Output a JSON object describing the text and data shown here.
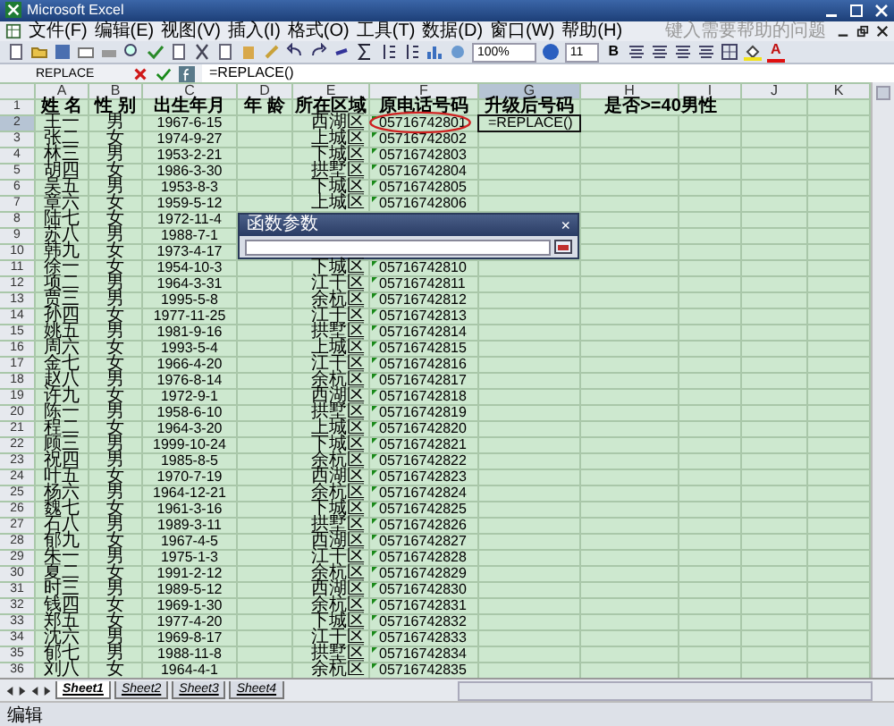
{
  "window": {
    "title": "Microsoft Excel"
  },
  "menu": [
    "文件(F)",
    "编辑(E)",
    "视图(V)",
    "插入(I)",
    "格式(O)",
    "工具(T)",
    "数据(D)",
    "窗口(W)",
    "帮助(H)"
  ],
  "help_box": {
    "placeholder": "键入需要帮助的问题"
  },
  "toolbar": {
    "zoom": "100%",
    "font_size": "11",
    "bold": "B",
    "font_color": "A"
  },
  "formula_bar": {
    "name_box": "REPLACE",
    "formula": "=REPLACE()"
  },
  "columns": [
    {
      "letter": "A",
      "selected": false
    },
    {
      "letter": "B",
      "selected": false
    },
    {
      "letter": "C",
      "selected": false
    },
    {
      "letter": "D",
      "selected": false
    },
    {
      "letter": "E",
      "selected": false
    },
    {
      "letter": "F",
      "selected": false
    },
    {
      "letter": "G",
      "selected": true
    },
    {
      "letter": "H",
      "selected": false
    },
    {
      "letter": "I",
      "selected": false
    },
    {
      "letter": "J",
      "selected": false
    },
    {
      "letter": "K",
      "selected": false
    }
  ],
  "rows": [
    {
      "number": "1",
      "selected": false,
      "header": true,
      "flagged": false,
      "cells": {
        "A": "姓 名",
        "B": "性 别",
        "C": "出生年月",
        "D": "年 龄",
        "E": "所在区域",
        "F": "原电话号码",
        "G": "升级后号码",
        "H": "是否>=40男性"
      }
    },
    {
      "number": "2",
      "selected": true,
      "header": false,
      "flagged": true,
      "cells": {
        "A": "王一",
        "B": "男",
        "C": "1967-6-15",
        "E": "西湖区",
        "F": "05716742801",
        "G": "=REPLACE()"
      }
    },
    {
      "number": "3",
      "selected": false,
      "header": false,
      "flagged": true,
      "cells": {
        "A": "张二",
        "B": "女",
        "C": "1974-9-27",
        "E": "上城区",
        "F": "05716742802"
      }
    },
    {
      "number": "4",
      "selected": false,
      "header": false,
      "flagged": true,
      "cells": {
        "A": "林三",
        "B": "男",
        "C": "1953-2-21",
        "E": "下城区",
        "F": "05716742803"
      }
    },
    {
      "number": "5",
      "selected": false,
      "header": false,
      "flagged": true,
      "cells": {
        "A": "胡四",
        "B": "女",
        "C": "1986-3-30",
        "E": "拱墅区",
        "F": "05716742804"
      }
    },
    {
      "number": "6",
      "selected": false,
      "header": false,
      "flagged": true,
      "cells": {
        "A": "吴五",
        "B": "男",
        "C": "1953-8-3",
        "E": "下城区",
        "F": "05716742805"
      }
    },
    {
      "number": "7",
      "selected": false,
      "header": false,
      "flagged": true,
      "cells": {
        "A": "章六",
        "B": "女",
        "C": "1959-5-12",
        "E": "上城区",
        "F": "05716742806"
      }
    },
    {
      "number": "8",
      "selected": false,
      "header": false,
      "flagged": false,
      "cells": {
        "A": "陆七",
        "B": "女",
        "C": "1972-11-4"
      }
    },
    {
      "number": "9",
      "selected": false,
      "header": false,
      "flagged": false,
      "cells": {
        "A": "苏八",
        "B": "男",
        "C": "1988-7-1"
      }
    },
    {
      "number": "10",
      "selected": false,
      "header": false,
      "flagged": false,
      "cells": {
        "A": "韩九",
        "B": "女",
        "C": "1973-4-17"
      }
    },
    {
      "number": "11",
      "selected": false,
      "header": false,
      "flagged": true,
      "cells": {
        "A": "徐一",
        "B": "女",
        "C": "1954-10-3",
        "E": "下城区",
        "F": "05716742810"
      }
    },
    {
      "number": "12",
      "selected": false,
      "header": false,
      "flagged": true,
      "cells": {
        "A": "项二",
        "B": "男",
        "C": "1964-3-31",
        "E": "江干区",
        "F": "05716742811"
      }
    },
    {
      "number": "13",
      "selected": false,
      "header": false,
      "flagged": true,
      "cells": {
        "A": "贾三",
        "B": "男",
        "C": "1995-5-8",
        "E": "余杭区",
        "F": "05716742812"
      }
    },
    {
      "number": "14",
      "selected": false,
      "header": false,
      "flagged": true,
      "cells": {
        "A": "孙四",
        "B": "女",
        "C": "1977-11-25",
        "E": "江干区",
        "F": "05716742813"
      }
    },
    {
      "number": "15",
      "selected": false,
      "header": false,
      "flagged": true,
      "cells": {
        "A": "姚五",
        "B": "男",
        "C": "1981-9-16",
        "E": "拱墅区",
        "F": "05716742814"
      }
    },
    {
      "number": "16",
      "selected": false,
      "header": false,
      "flagged": true,
      "cells": {
        "A": "周六",
        "B": "女",
        "C": "1993-5-4",
        "E": "上城区",
        "F": "05716742815"
      }
    },
    {
      "number": "17",
      "selected": false,
      "header": false,
      "flagged": true,
      "cells": {
        "A": "金七",
        "B": "女",
        "C": "1966-4-20",
        "E": "江干区",
        "F": "05716742816"
      }
    },
    {
      "number": "18",
      "selected": false,
      "header": false,
      "flagged": true,
      "cells": {
        "A": "赵八",
        "B": "男",
        "C": "1976-8-14",
        "E": "余杭区",
        "F": "05716742817"
      }
    },
    {
      "number": "19",
      "selected": false,
      "header": false,
      "flagged": true,
      "cells": {
        "A": "许九",
        "B": "女",
        "C": "1972-9-1",
        "E": "西湖区",
        "F": "05716742818"
      }
    },
    {
      "number": "20",
      "selected": false,
      "header": false,
      "flagged": true,
      "cells": {
        "A": "陈一",
        "B": "男",
        "C": "1958-6-10",
        "E": "拱墅区",
        "F": "05716742819"
      }
    },
    {
      "number": "21",
      "selected": false,
      "header": false,
      "flagged": true,
      "cells": {
        "A": "程二",
        "B": "女",
        "C": "1964-3-20",
        "E": "上城区",
        "F": "05716742820"
      }
    },
    {
      "number": "22",
      "selected": false,
      "header": false,
      "flagged": true,
      "cells": {
        "A": "顾三",
        "B": "男",
        "C": "1999-10-24",
        "E": "下城区",
        "F": "05716742821"
      }
    },
    {
      "number": "23",
      "selected": false,
      "header": false,
      "flagged": true,
      "cells": {
        "A": "祝四",
        "B": "男",
        "C": "1985-8-5",
        "E": "余杭区",
        "F": "05716742822"
      }
    },
    {
      "number": "24",
      "selected": false,
      "header": false,
      "flagged": true,
      "cells": {
        "A": "叶五",
        "B": "女",
        "C": "1970-7-19",
        "E": "西湖区",
        "F": "05716742823"
      }
    },
    {
      "number": "25",
      "selected": false,
      "header": false,
      "flagged": true,
      "cells": {
        "A": "杨六",
        "B": "男",
        "C": "1964-12-21",
        "E": "余杭区",
        "F": "05716742824"
      }
    },
    {
      "number": "26",
      "selected": false,
      "header": false,
      "flagged": true,
      "cells": {
        "A": "魏七",
        "B": "女",
        "C": "1961-3-16",
        "E": "下城区",
        "F": "05716742825"
      }
    },
    {
      "number": "27",
      "selected": false,
      "header": false,
      "flagged": true,
      "cells": {
        "A": "石八",
        "B": "男",
        "C": "1989-3-11",
        "E": "拱墅区",
        "F": "05716742826"
      }
    },
    {
      "number": "28",
      "selected": false,
      "header": false,
      "flagged": true,
      "cells": {
        "A": "郁九",
        "B": "女",
        "C": "1967-4-5",
        "E": "西湖区",
        "F": "05716742827"
      }
    },
    {
      "number": "29",
      "selected": false,
      "header": false,
      "flagged": true,
      "cells": {
        "A": "朱一",
        "B": "男",
        "C": "1975-1-3",
        "E": "江干区",
        "F": "05716742828"
      }
    },
    {
      "number": "30",
      "selected": false,
      "header": false,
      "flagged": true,
      "cells": {
        "A": "夏二",
        "B": "女",
        "C": "1991-2-12",
        "E": "余杭区",
        "F": "05716742829"
      }
    },
    {
      "number": "31",
      "selected": false,
      "header": false,
      "flagged": true,
      "cells": {
        "A": "时三",
        "B": "男",
        "C": "1989-5-12",
        "E": "西湖区",
        "F": "05716742830"
      }
    },
    {
      "number": "32",
      "selected": false,
      "header": false,
      "flagged": true,
      "cells": {
        "A": "钱四",
        "B": "女",
        "C": "1969-1-30",
        "E": "余杭区",
        "F": "05716742831"
      }
    },
    {
      "number": "33",
      "selected": false,
      "header": false,
      "flagged": true,
      "cells": {
        "A": "郑五",
        "B": "女",
        "C": "1977-4-20",
        "E": "下城区",
        "F": "05716742832"
      }
    },
    {
      "number": "34",
      "selected": false,
      "header": false,
      "flagged": true,
      "cells": {
        "A": "沈六",
        "B": "男",
        "C": "1969-8-17",
        "E": "江干区",
        "F": "05716742833"
      }
    },
    {
      "number": "35",
      "selected": false,
      "header": false,
      "flagged": true,
      "cells": {
        "A": "郁七",
        "B": "男",
        "C": "1988-11-8",
        "E": "拱墅区",
        "F": "05716742834"
      }
    },
    {
      "number": "36",
      "selected": false,
      "header": false,
      "flagged": true,
      "cells": {
        "A": "刘八",
        "B": "女",
        "C": "1964-4-1",
        "E": "余杭区",
        "F": "05716742835"
      }
    }
  ],
  "dialog": {
    "title": "函数参数",
    "close": "×"
  },
  "sheet_tabs": [
    {
      "label": "Sheet1",
      "selected": true
    },
    {
      "label": "Sheet2",
      "selected": false
    },
    {
      "label": "Sheet3",
      "selected": false
    },
    {
      "label": "Sheet4",
      "selected": false
    }
  ],
  "status_bar": "编辑"
}
